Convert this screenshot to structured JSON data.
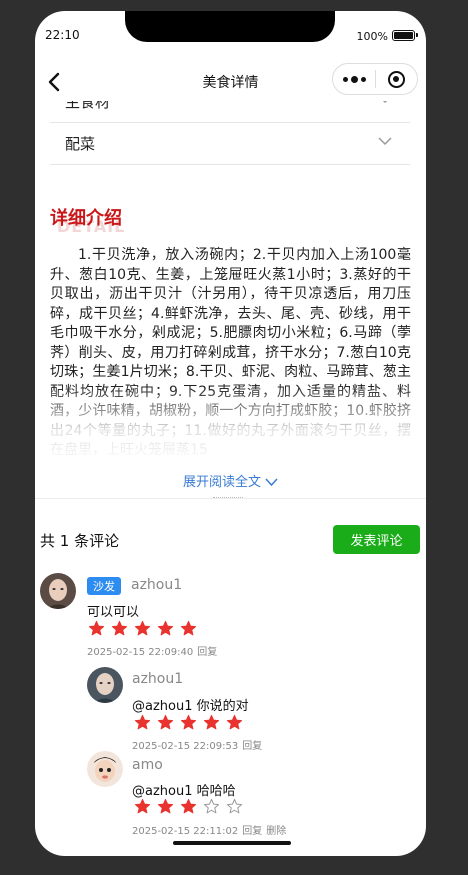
{
  "status": {
    "time": "22:10",
    "battery": "100%",
    "battery_level": 1.0
  },
  "nav": {
    "title": "美食详情"
  },
  "accordion": [
    {
      "label": "主食材"
    },
    {
      "label": "配菜"
    }
  ],
  "detail": {
    "title": "详细介绍",
    "subtitle": "DETAIL",
    "text": "1.干贝洗净，放入汤碗内；2.干贝内加入上汤100毫升、葱白10克、生姜，上笼屉旺火蒸1小时；3.蒸好的干贝取出，沥出干贝汁（汁另用），待干贝凉透后，用刀压碎，成干贝丝；4.鲜虾洗净，去头、尾、壳、砂线，用干毛巾吸干水分，剁成泥；5.肥膘肉切小米粒；6.马蹄（荸荠）削头、皮，用刀打碎剁成茸，挤干水分；7.葱白10克切珠；生姜1片切米；8.干贝、虾泥、肉粒、马蹄茸、葱主配料均放在碗中；9.下25克蛋清，加入适量的精盐、料酒，少许味精，胡椒粉，顺一个方向打成虾胶；10.虾胶挤出24个等量的丸子；11.做好的丸子外面滚匀干贝丝，摆在盘里，上旺火笼屉蒸15",
    "expand_label": "展开阅读全文"
  },
  "comments": {
    "title": "共 1 条评论",
    "post_label": "发表评论",
    "items": [
      {
        "badge": "沙发",
        "user": "azhou1",
        "text": "可以可以",
        "rating": 5,
        "time": "2025-02-15 22:09:40",
        "reply_label": "回复",
        "replies": [
          {
            "user": "azhou1",
            "text": "@azhou1 你说的对",
            "rating": 5,
            "time": "2025-02-15 22:09:53",
            "reply_label": "回复"
          },
          {
            "user": "amo",
            "text": "@azhou1 哈哈哈",
            "rating": 3,
            "time": "2025-02-15 22:11:02",
            "reply_label": "回复",
            "delete_label": "删除"
          }
        ]
      }
    ]
  },
  "colors": {
    "accent_red": "#c9171a",
    "star_red": "#e8332e",
    "link_blue": "#3a7bd5",
    "button_green": "#1aad19",
    "badge_blue": "#2d8cf0"
  }
}
